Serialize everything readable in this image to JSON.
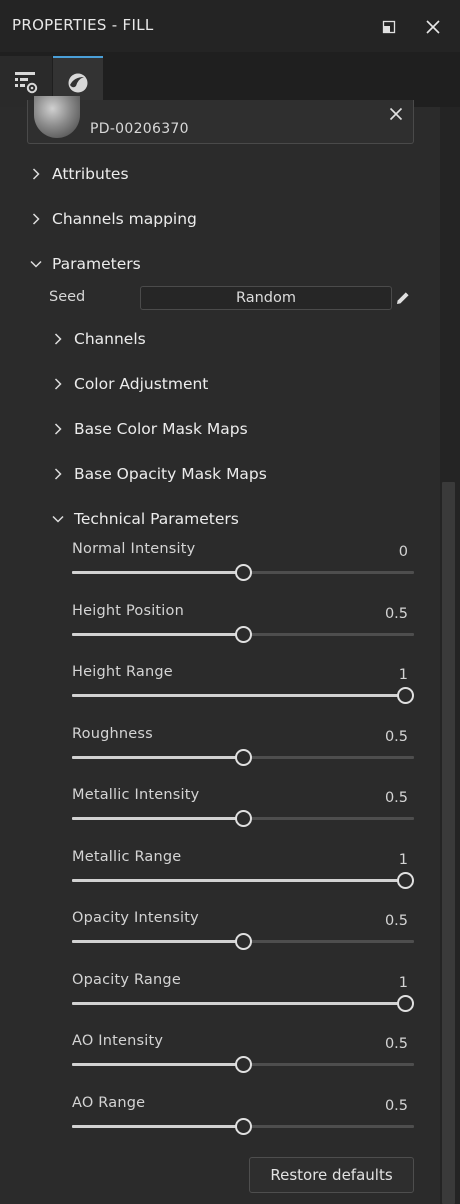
{
  "window": {
    "title": "PROPERTIES - FILL"
  },
  "tabs": [
    {
      "icon": "layer-properties-icon"
    },
    {
      "icon": "material-sphere-icon"
    }
  ],
  "resource": {
    "name": "PD-00206370"
  },
  "sections": {
    "attributes": "Attributes",
    "channels_mapping": "Channels mapping",
    "parameters": "Parameters"
  },
  "seed": {
    "label": "Seed",
    "button": "Random"
  },
  "subsections": {
    "channels": "Channels",
    "color_adjustment": "Color Adjustment",
    "base_color_mask_maps": "Base Color Mask Maps",
    "base_opacity_mask_maps": "Base Opacity Mask Maps",
    "technical_parameters": "Technical Parameters"
  },
  "params": [
    {
      "label": "Normal Intensity",
      "value": "0",
      "level": 0.5
    },
    {
      "label": "Height Position",
      "value": "0.5",
      "level": 0.5
    },
    {
      "label": "Height Range",
      "value": "1",
      "level": 1.0
    },
    {
      "label": "Roughness",
      "value": "0.5",
      "level": 0.5
    },
    {
      "label": "Metallic Intensity",
      "value": "0.5",
      "level": 0.5
    },
    {
      "label": "Metallic Range",
      "value": "1",
      "level": 1.0
    },
    {
      "label": "Opacity Intensity",
      "value": "0.5",
      "level": 0.5
    },
    {
      "label": "Opacity Range",
      "value": "1",
      "level": 1.0
    },
    {
      "label": "AO Intensity",
      "value": "0.5",
      "level": 0.5
    },
    {
      "label": "AO Range",
      "value": "0.5",
      "level": 0.5
    }
  ],
  "restore_button": "Restore defaults",
  "colors": {
    "accent": "#4a9fd8",
    "panel": "#2b2b2b",
    "slider_fill": "#d2d2d2"
  }
}
